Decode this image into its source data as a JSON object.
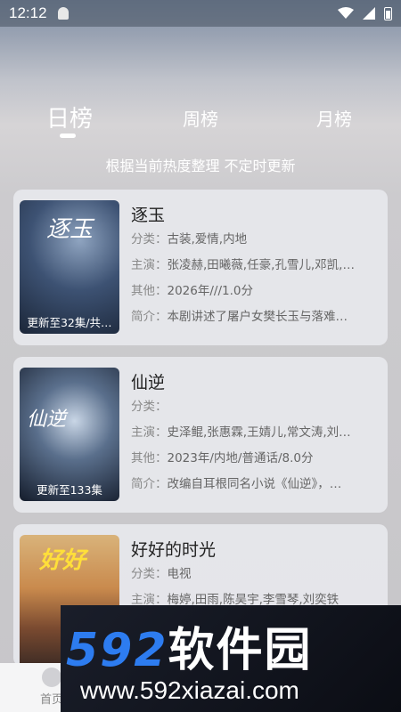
{
  "status": {
    "time": "12:12"
  },
  "tabs": [
    {
      "label": "日榜"
    },
    {
      "label": "周榜"
    },
    {
      "label": "月榜"
    }
  ],
  "subtitle": "根据当前热度整理 不定时更新",
  "items": [
    {
      "title": "逐玉",
      "poster_text": "逐玉",
      "badge": "更新至32集/共…",
      "category_key": "分类：",
      "category": "古装,爱情,内地",
      "cast_key": "主演：",
      "cast": "张凌赫,田曦薇,任豪,孔雪儿,邓凯,…",
      "other_key": "其他：",
      "other": "2026年///1.0分",
      "intro_key": "简介：",
      "intro": "本剧讲述了屠户女樊长玉与落难…"
    },
    {
      "title": "仙逆",
      "poster_text": "仙逆",
      "badge": "更新至133集",
      "category_key": "分类：",
      "category": "",
      "cast_key": "主演：",
      "cast": "史泽鲲,张惠霖,王婧儿,常文涛,刘…",
      "other_key": "其他：",
      "other": "2023年/内地/普通话/8.0分",
      "intro_key": "简介：",
      "intro": "改编自耳根同名小说《仙逆》，…"
    },
    {
      "title": "好好的时光",
      "poster_text": "好好",
      "badge": "",
      "category_key": "分类：",
      "category": "电视",
      "cast_key": "主演：",
      "cast": "梅婷,田雨,陈昊宇,李雪琴,刘奕铁",
      "other_key": "",
      "other": "",
      "intro_key": "",
      "intro": ""
    }
  ],
  "nav": {
    "home_label": "首页"
  },
  "watermark": {
    "num": "592",
    "cn": "软件园",
    "url": "www.592xiazai.com"
  },
  "colors": {
    "accent": "#2d7cf0"
  }
}
